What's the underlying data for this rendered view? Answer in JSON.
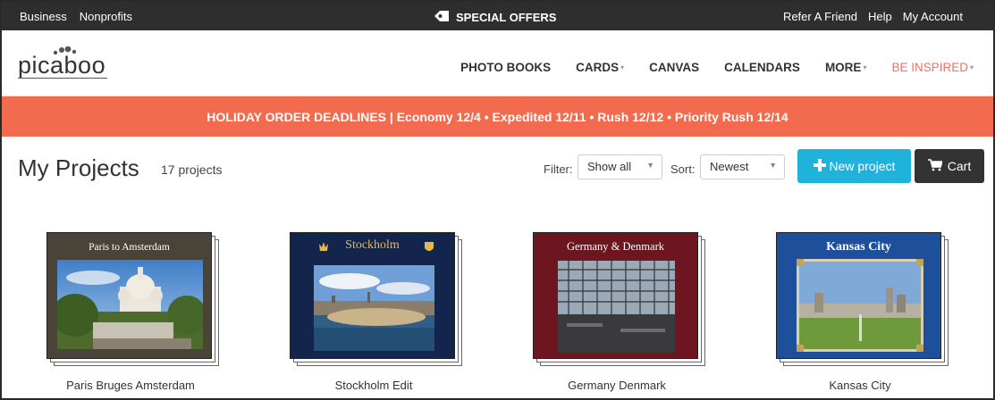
{
  "topbar": {
    "left_links": [
      "Business",
      "Nonprofits"
    ],
    "special_offers": "SPECIAL OFFERS",
    "right_links": [
      "Refer A Friend",
      "Help",
      "My Account"
    ]
  },
  "logo": {
    "text": "picaboo"
  },
  "nav": {
    "items": [
      {
        "label": "PHOTO BOOKS",
        "caret": false
      },
      {
        "label": "CARDS",
        "caret": true
      },
      {
        "label": "CANVAS",
        "caret": false
      },
      {
        "label": "CALENDARS",
        "caret": false
      },
      {
        "label": "MORE",
        "caret": true
      },
      {
        "label": "BE INSPIRED",
        "caret": true
      }
    ],
    "caret_glyph": "▾"
  },
  "banner": {
    "text": "HOLIDAY ORDER DEADLINES | Economy 12/4 • Expedited 12/11 • Rush 12/12 • Priority Rush 12/14"
  },
  "projects_header": {
    "title": "My Projects",
    "count": "17 projects",
    "filter_label": "Filter:",
    "filter_value": "Show all",
    "sort_label": "Sort:",
    "sort_value": "Newest",
    "new_project_label": "New project",
    "cart_label": "Cart"
  },
  "projects": [
    {
      "name": "Paris Bruges Amsterdam",
      "cover_title": "Paris to Amsterdam",
      "cover_color": "#4a4338"
    },
    {
      "name": "Stockholm Edit",
      "cover_title": "Stockholm",
      "cover_color": "#14254d"
    },
    {
      "name": "Germany Denmark",
      "cover_title": "Germany & Denmark",
      "cover_color": "#6d1620"
    },
    {
      "name": "Kansas City",
      "cover_title": "Kansas City",
      "cover_color": "#1d4f9a"
    }
  ],
  "colors": {
    "topbar": "#2e2e2e",
    "banner": "#f26b4f",
    "new_button": "#1fb3dc",
    "cart_button": "#333333",
    "inspired_link": "#f07060"
  }
}
